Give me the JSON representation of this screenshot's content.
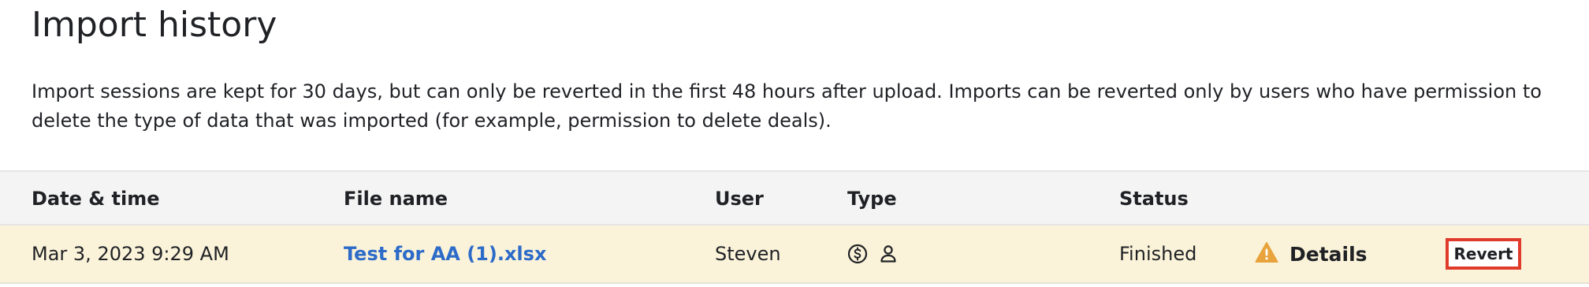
{
  "page": {
    "title": "Import history",
    "description": "Import sessions are kept for 30 days, but can only be reverted in the first 48 hours after upload. Imports can be reverted only by users who have permission to delete the type of data that was imported (for example, permission to delete deals)."
  },
  "table": {
    "headers": {
      "date_time": "Date & time",
      "file_name": "File name",
      "user": "User",
      "type": "Type",
      "status": "Status"
    },
    "rows": [
      {
        "date_time": "Mar 3, 2023 9:29 AM",
        "file_name": "Test for AA (1).xlsx",
        "user": "Steven",
        "type_icons": [
          "dollar-circle-icon",
          "person-icon"
        ],
        "status": "Finished",
        "details_label": "Details",
        "details_icon": "warning-icon",
        "revert_label": "Revert"
      }
    ]
  },
  "colors": {
    "link": "#2d6bc9",
    "row_highlight": "#fbf3d9",
    "header_bg": "#f4f4f4",
    "warning": "#e8a33d",
    "revert_border": "#e03a2b"
  }
}
